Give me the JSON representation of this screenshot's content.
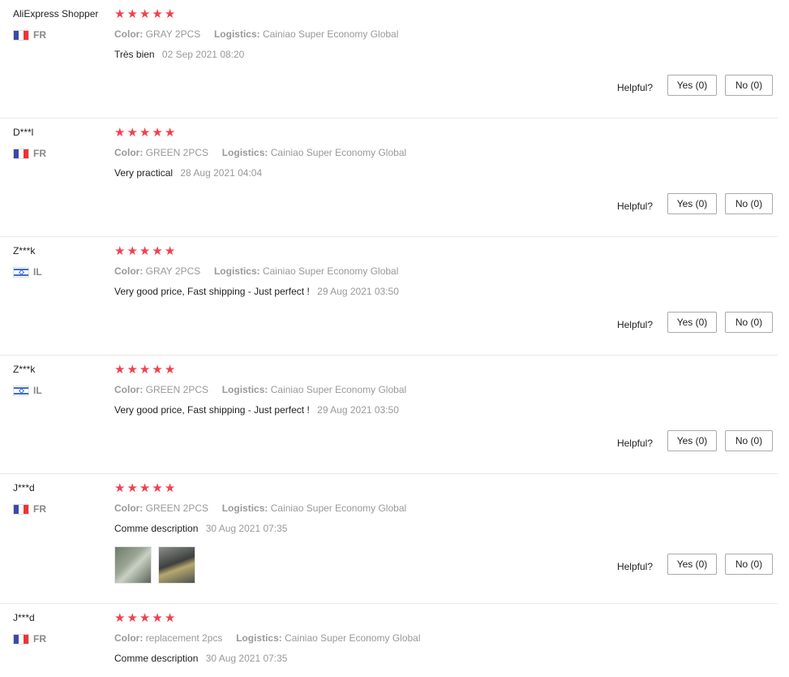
{
  "helpful_label": "Helpful?",
  "colors": {
    "star": "#f2404e",
    "meta": "#999999",
    "divider": "#e8e8e8"
  },
  "reviews": [
    {
      "name": "AliExpress Shopper",
      "country": "FR",
      "flag": "fr-flag-icon",
      "rating": 5,
      "color_label": "Color:",
      "color": "GRAY 2PCS",
      "logistics_label": "Logistics:",
      "logistics": "Cainiao Super Economy Global",
      "text": "Très bien",
      "date": "02 Sep 2021 08:20",
      "yes": "Yes (0)",
      "no": "No (0)"
    },
    {
      "name": "D***l",
      "country": "FR",
      "flag": "fr-flag-icon",
      "rating": 5,
      "color_label": "Color:",
      "color": "GREEN 2PCS",
      "logistics_label": "Logistics:",
      "logistics": "Cainiao Super Economy Global",
      "text": "Very practical",
      "date": "28 Aug 2021 04:04",
      "yes": "Yes (0)",
      "no": "No (0)"
    },
    {
      "name": "Z***k",
      "country": "IL",
      "flag": "il-flag-icon",
      "rating": 5,
      "color_label": "Color:",
      "color": "GRAY 2PCS",
      "logistics_label": "Logistics:",
      "logistics": "Cainiao Super Economy Global",
      "text": "Very good price, Fast shipping - Just perfect !",
      "date": "29 Aug 2021 03:50",
      "yes": "Yes (0)",
      "no": "No (0)"
    },
    {
      "name": "Z***k",
      "country": "IL",
      "flag": "il-flag-icon",
      "rating": 5,
      "color_label": "Color:",
      "color": "GREEN 2PCS",
      "logistics_label": "Logistics:",
      "logistics": "Cainiao Super Economy Global",
      "text": "Very good price, Fast shipping - Just perfect !",
      "date": "29 Aug 2021 03:50",
      "yes": "Yes (0)",
      "no": "No (0)"
    },
    {
      "name": "J***d",
      "country": "FR",
      "flag": "fr-flag-icon",
      "rating": 5,
      "color_label": "Color:",
      "color": "GREEN 2PCS",
      "logistics_label": "Logistics:",
      "logistics": "Cainiao Super Economy Global",
      "text": "Comme description",
      "date": "30 Aug 2021 07:35",
      "photos": 2,
      "yes": "Yes (0)",
      "no": "No (0)"
    },
    {
      "name": "J***d",
      "country": "FR",
      "flag": "fr-flag-icon",
      "rating": 5,
      "color_label": "Color:",
      "color": "replacement 2pcs",
      "logistics_label": "Logistics:",
      "logistics": "Cainiao Super Economy Global",
      "text": "Comme description",
      "date": "30 Aug 2021 07:35"
    }
  ]
}
